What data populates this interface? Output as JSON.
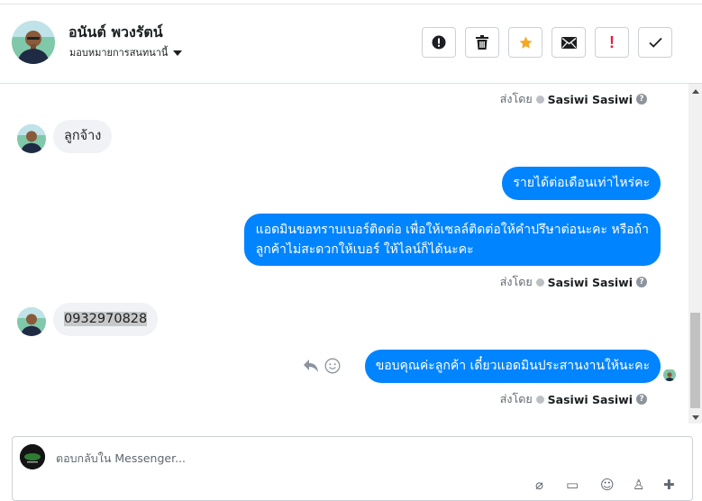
{
  "header": {
    "contact_name": "อนันต์ พวงรัตน์",
    "assign_label": "มอบหมายการสนทนานี้",
    "actions": [
      {
        "name": "report-spam",
        "glyph": "!"
      },
      {
        "name": "delete",
        "glyph": "🗑"
      },
      {
        "name": "star",
        "glyph": "★"
      },
      {
        "name": "mark-unread",
        "glyph": "✉"
      },
      {
        "name": "follow-up",
        "glyph": "!"
      },
      {
        "name": "mark-done",
        "glyph": "✓"
      }
    ]
  },
  "messages": [
    {
      "type": "sent_by",
      "prefix": "ส่งโดย",
      "agent": "Sasiwi Sasiwi"
    },
    {
      "type": "incoming",
      "text": "ลูกจ้าง"
    },
    {
      "type": "outgoing",
      "text": "รายได้ต่อเดือนเท่าไหร่คะ"
    },
    {
      "type": "outgoing",
      "lines": [
        "แอดมินขอทราบเบอร์ติดต่อ เพื่อให้เซลล์ติดต่อให้คำปรึษาต่อนะคะ หรือถ้า",
        "ลูกค้าไม่สะดวกให้เบอร์ ให้ไลน์ก็ได้นะคะ"
      ]
    },
    {
      "type": "sent_by",
      "prefix": "ส่งโดย",
      "agent": "Sasiwi Sasiwi"
    },
    {
      "type": "incoming",
      "text": "0932970828"
    },
    {
      "type": "outgoing",
      "text": "ขอบคุณค่ะลูกค้า เดี๋ยวแอดมินประสานงานให้นะคะ"
    },
    {
      "type": "sent_by",
      "prefix": "ส่งโดย",
      "agent": "Sasiwi Sasiwi"
    }
  ],
  "composer": {
    "placeholder": "ตอบกลับใน Messenger..."
  },
  "colors": {
    "outgoing_bubble": "#0084ff",
    "incoming_bubble": "#f0f2f5",
    "star": "#f5a623",
    "follow_up": "#e41e3f"
  }
}
